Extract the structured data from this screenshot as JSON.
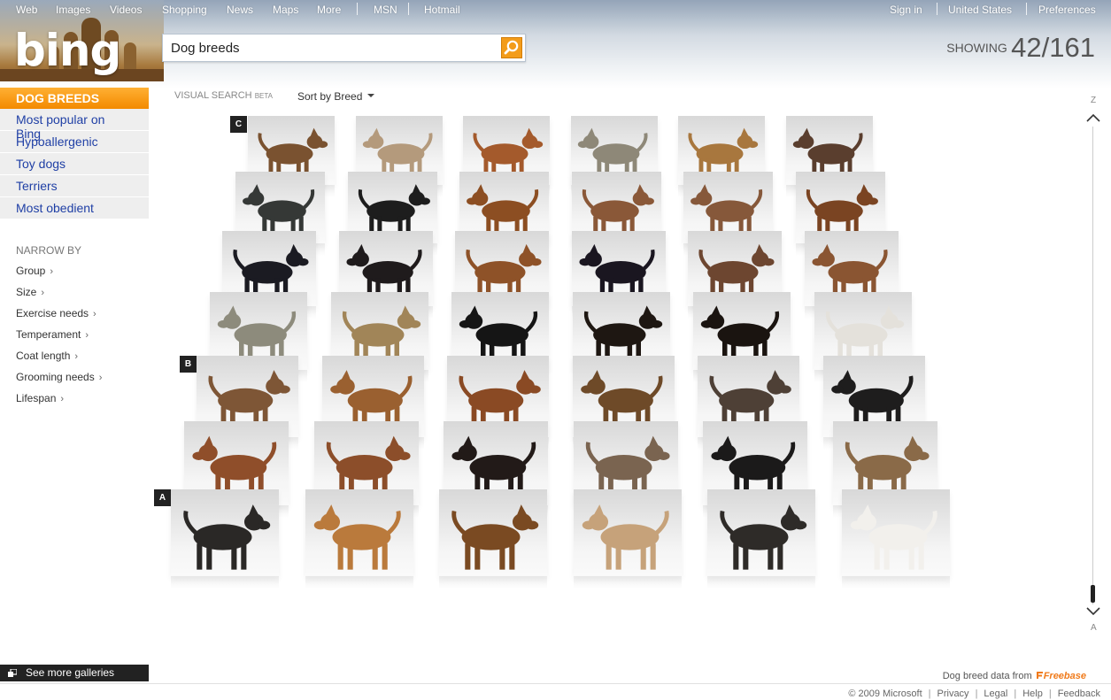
{
  "nav": {
    "links": [
      "Web",
      "Images",
      "Videos",
      "Shopping",
      "News",
      "Maps",
      "More",
      "MSN",
      "Hotmail"
    ],
    "right": [
      "Sign in",
      "United States",
      "Preferences"
    ]
  },
  "brand": {
    "logo_text": "bing",
    "accent": "#f39c1a",
    "link_color": "#1f3fa5"
  },
  "search": {
    "value": "Dog breeds",
    "button_icon": "search-icon"
  },
  "showing": {
    "label": "SHOWING",
    "count": "42/161"
  },
  "sidebar": {
    "title": "DOG BREEDS",
    "items": [
      "Most popular on Bing",
      "Hypoallergenic",
      "Toy dogs",
      "Terriers",
      "Most obedient"
    ],
    "narrow_by": {
      "title": "NARROW BY",
      "items": [
        "Group",
        "Size",
        "Exercise needs",
        "Temperament",
        "Coat length",
        "Grooming needs",
        "Lifespan"
      ],
      "chevron": "›"
    }
  },
  "toolbar": {
    "visual_search": "VISUAL SEARCH",
    "beta": "BETA",
    "sort": "Sort by Breed",
    "sort_icon": "caret-down-icon"
  },
  "row_markers": [
    "C",
    "B",
    "A"
  ],
  "slider": {
    "top_label": "Z",
    "bottom_label": "A"
  },
  "gallery": {
    "rows": [
      [
        "#7a5230",
        "#b49a7c",
        "#a45a2c",
        "#8e8878",
        "#a8773e",
        "#5a3e2e"
      ],
      [
        "#353836",
        "#1d1d1d",
        "#8c4e22",
        "#8a5838",
        "#86583a",
        "#7a4422"
      ],
      [
        "#1b1b22",
        "#1f1b1c",
        "#8e5228",
        "#1a1620",
        "#6d4630",
        "#8a5532"
      ],
      [
        "#8d8b7c",
        "#a18558",
        "#151515",
        "#1e1712",
        "#1a1410",
        "#e4e1db"
      ],
      [
        "#7e5636",
        "#9a6030",
        "#8a4a24",
        "#6e4a28",
        "#4e4036",
        "#1e1d1d"
      ],
      [
        "#8f4e2a",
        "#8c4e2a",
        "#221a18",
        "#7a6450",
        "#1b1a1a",
        "#8a6a48"
      ],
      [
        "#2a2826",
        "#ba7a3c",
        "#7a4a22",
        "#c6a27a",
        "#2e2b28",
        "#f2f0ec"
      ]
    ]
  },
  "bottom": {
    "see_more": "See more galleries",
    "data_credit": "Dog breed data from",
    "freebase": "Freebase",
    "footer": [
      "© 2009 Microsoft",
      "Privacy",
      "Legal",
      "Help",
      "Feedback"
    ]
  }
}
